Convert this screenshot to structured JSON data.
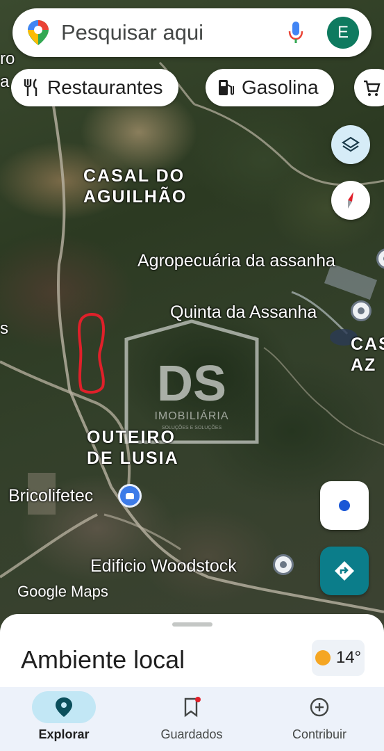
{
  "search": {
    "placeholder": "Pesquisar aqui",
    "avatar_letter": "E"
  },
  "chips": [
    {
      "label": "Restaurantes",
      "icon": "fork-knife-icon"
    },
    {
      "label": "Gasolina",
      "icon": "gas-station-icon"
    },
    {
      "label": "",
      "icon": "shopping-cart-icon"
    }
  ],
  "map": {
    "places": [
      {
        "name": "CASAL DO\nAGUILHÃO"
      },
      {
        "name": "OUTEIRO\nDE LUSIA"
      },
      {
        "name": "CAS\nAZ"
      }
    ],
    "pois": [
      {
        "name": "Agropecuária da assanha"
      },
      {
        "name": "Quinta da Assanha"
      },
      {
        "name": "Bricolifetec"
      },
      {
        "name": "Edificio Woodstock"
      }
    ],
    "edge_labels": [
      "ro",
      "a",
      "s"
    ],
    "watermark": {
      "logo": "DS",
      "text": "IMOBILIÁRIA",
      "subtext": "SOLUÇÕES E SOLUÇÕES"
    },
    "attribution": "Google Maps"
  },
  "sheet": {
    "title": "Ambiente local",
    "temperature": "14°"
  },
  "nav": [
    {
      "label": "Explorar",
      "icon": "location-pin-icon",
      "active": true
    },
    {
      "label": "Guardados",
      "icon": "bookmark-icon",
      "active": false
    },
    {
      "label": "Contribuir",
      "icon": "add-circle-icon",
      "active": false
    }
  ],
  "colors": {
    "accent": "#0b7d8a",
    "highlight_outline": "#e0202a",
    "avatar": "#0e7a5f",
    "location_dot": "#1a57d6"
  }
}
